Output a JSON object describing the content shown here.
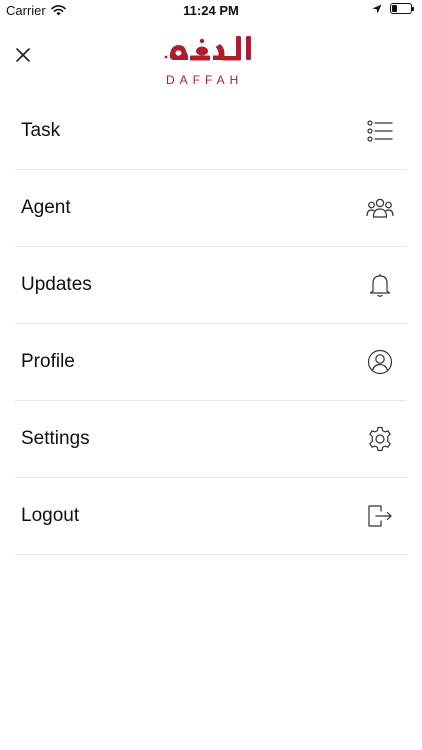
{
  "status_bar": {
    "carrier": "Carrier",
    "time": "11:24 PM",
    "icons": [
      "wifi-icon",
      "location-arrow-icon",
      "battery-icon"
    ],
    "battery_level": 0.25
  },
  "header": {
    "logo_arabic": "الدفه",
    "logo_latin": "DAFFAH",
    "brand_color": "#b01b2e"
  },
  "menu": {
    "items": [
      {
        "label": "Task",
        "icon": "list-icon"
      },
      {
        "label": "Agent",
        "icon": "group-icon"
      },
      {
        "label": "Updates",
        "icon": "bell-icon"
      },
      {
        "label": "Profile",
        "icon": "user-circle-icon"
      },
      {
        "label": "Settings",
        "icon": "gear-icon"
      },
      {
        "label": "Logout",
        "icon": "logout-icon"
      }
    ]
  }
}
